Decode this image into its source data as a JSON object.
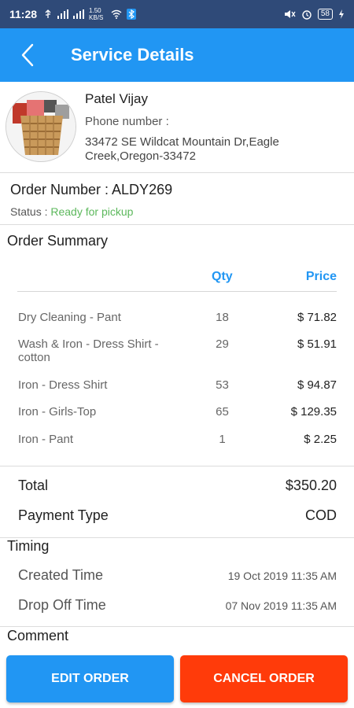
{
  "status_bar": {
    "time": "11:28",
    "data_speed": "1.50 KB/S",
    "battery": "58"
  },
  "header": {
    "title": "Service Details"
  },
  "customer": {
    "name": "Patel Vijay",
    "phone_label": "Phone number :",
    "address": "33472 SE Wildcat Mountain Dr,Eagle Creek,Oregon-33472"
  },
  "order": {
    "number_label": "Order Number : ALDY269",
    "status_label": "Status : ",
    "status_value": "Ready for pickup",
    "status_color": "#5cb85c"
  },
  "summary": {
    "title": "Order Summary",
    "columns": {
      "qty": "Qty",
      "price": "Price"
    },
    "items": [
      {
        "name": "Dry Cleaning - Pant",
        "qty": "18",
        "price": "$ 71.82"
      },
      {
        "name": "Wash & Iron - Dress Shirt - cotton",
        "qty": "29",
        "price": "$ 51.91"
      },
      {
        "name": "Iron - Dress Shirt",
        "qty": "53",
        "price": "$ 94.87"
      },
      {
        "name": "Iron - Girls-Top",
        "qty": "65",
        "price": "$ 129.35"
      },
      {
        "name": "Iron - Pant",
        "qty": "1",
        "price": "$ 2.25"
      }
    ],
    "total_label": "Total",
    "total_value": "$350.20",
    "payment_label": "Payment Type",
    "payment_value": "COD"
  },
  "timing": {
    "title": "Timing",
    "created_label": "Created Time",
    "created_value": "19 Oct 2019 11:35 AM",
    "dropoff_label": "Drop Off Time",
    "dropoff_value": "07 Nov 2019 11:35 AM"
  },
  "comment": {
    "title": "Comment"
  },
  "actions": {
    "edit_label": "EDIT ORDER",
    "cancel_label": "CANCEL ORDER",
    "edit_color": "#2196f3",
    "cancel_color": "#ff3b0a"
  },
  "icons": {
    "back": "chevron-left-icon",
    "avatar": "laundry-basket-image"
  }
}
